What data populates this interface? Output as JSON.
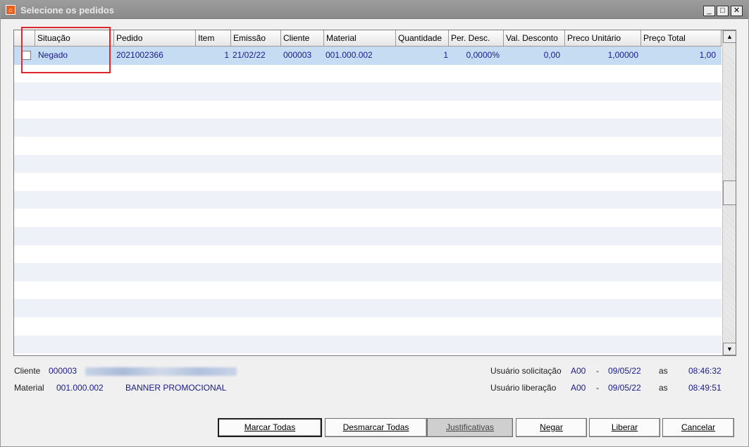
{
  "window": {
    "title": "Selecione os pedidos",
    "icon": "app-logo-icon",
    "controls": [
      "minimize-icon",
      "maximize-icon",
      "close-icon"
    ]
  },
  "grid": {
    "columns": [
      "Situação",
      "Pedido",
      "Item",
      "Emissão",
      "Cliente",
      "Material",
      "Quantidade",
      "Per. Desc.",
      "Val. Desconto",
      "Preco Unitário",
      "Preço Total"
    ],
    "rows": [
      {
        "checked": false,
        "situacao": "Negado",
        "pedido": "2021002366",
        "item": "1",
        "emissao": "21/02/22",
        "cliente": "000003",
        "material": "001.000.002",
        "quantidade": "1",
        "per_desc": "0,0000%",
        "val_desconto": "0,00",
        "preco_unitario": "1,00000",
        "preco_total": "1,00"
      }
    ],
    "selected_row_color": "#c6dcf3"
  },
  "info": {
    "cliente_label": "Cliente",
    "cliente_code": "000003",
    "material_label": "Material",
    "material_code": "001.000.002",
    "material_name": "BANNER PROMOCIONAL",
    "solicitacao_label": "Usuário solicitação",
    "solicitacao_user": "A00",
    "solicitacao_sep": "-",
    "solicitacao_date": "09/05/22",
    "solicitacao_as": "as",
    "solicitacao_time": "08:46:32",
    "liberacao_label": "Usuário liberação",
    "liberacao_user": "A00",
    "liberacao_sep": "-",
    "liberacao_date": "09/05/22",
    "liberacao_as": "as",
    "liberacao_time": "08:49:51"
  },
  "buttons": {
    "marcar": "Marcar Todas",
    "desmarcar": "Desmarcar Todas",
    "justificativas": "Justificativas",
    "negar": "Negar",
    "liberar": "Liberar",
    "cancelar": "Cancelar"
  }
}
